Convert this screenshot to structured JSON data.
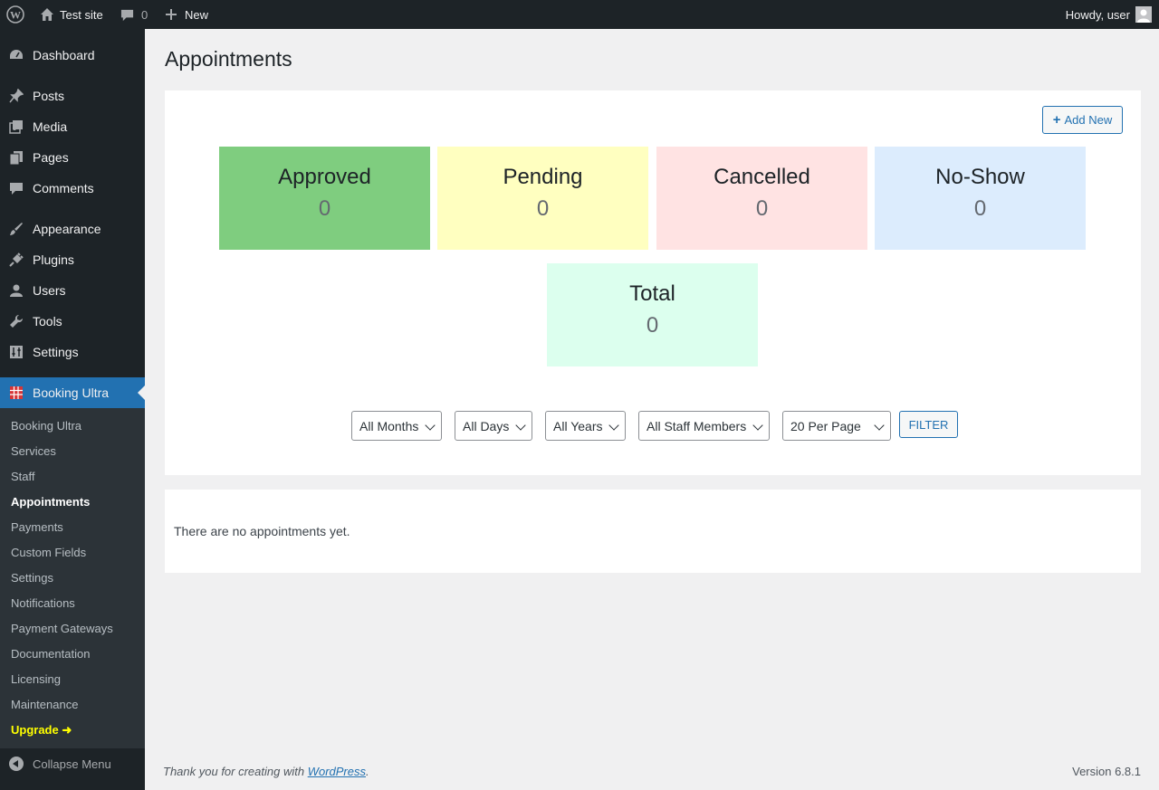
{
  "admin_bar": {
    "site_name": "Test site",
    "comments_count": "0",
    "new_label": "New",
    "howdy": "Howdy, user"
  },
  "sidebar": {
    "items": [
      {
        "label": "Dashboard",
        "icon": "dashboard-icon"
      },
      {
        "label": "Posts",
        "icon": "pushpin-icon"
      },
      {
        "label": "Media",
        "icon": "media-icon"
      },
      {
        "label": "Pages",
        "icon": "pages-icon"
      },
      {
        "label": "Comments",
        "icon": "comment-icon"
      },
      {
        "label": "Appearance",
        "icon": "paintbrush-icon"
      },
      {
        "label": "Plugins",
        "icon": "plugin-icon"
      },
      {
        "label": "Users",
        "icon": "user-icon"
      },
      {
        "label": "Tools",
        "icon": "wrench-icon"
      },
      {
        "label": "Settings",
        "icon": "settings-icon"
      },
      {
        "label": "Booking Ultra",
        "icon": "calendar-grid-icon"
      }
    ],
    "submenu": [
      {
        "label": "Booking Ultra"
      },
      {
        "label": "Services"
      },
      {
        "label": "Staff"
      },
      {
        "label": "Appointments"
      },
      {
        "label": "Payments"
      },
      {
        "label": "Custom Fields"
      },
      {
        "label": "Settings"
      },
      {
        "label": "Notifications"
      },
      {
        "label": "Payment Gateways"
      },
      {
        "label": "Documentation"
      },
      {
        "label": "Licensing"
      },
      {
        "label": "Maintenance"
      },
      {
        "label": "Upgrade ➜"
      }
    ],
    "collapse_label": "Collapse Menu"
  },
  "page": {
    "title": "Appointments",
    "add_new_label": "Add New",
    "stats": [
      {
        "label": "Approved",
        "value": "0",
        "color": "#7fcd7f"
      },
      {
        "label": "Pending",
        "value": "0",
        "color": "#ffffc0"
      },
      {
        "label": "Cancelled",
        "value": "0",
        "color": "#ffe3e3"
      },
      {
        "label": "No-Show",
        "value": "0",
        "color": "#dcecfd"
      },
      {
        "label": "Total",
        "value": "0",
        "color": "#dcffee"
      }
    ],
    "filters": {
      "months": "All Months",
      "days": "All Days",
      "years": "All Years",
      "staff": "All Staff Members",
      "per_page": "20 Per Page",
      "filter_label": "FILTER"
    },
    "empty_message": "There are no appointments yet."
  },
  "footer": {
    "thanks_prefix": "Thank you for creating with ",
    "thanks_link": "WordPress",
    "thanks_suffix": ".",
    "version": "Version 6.8.1"
  },
  "colors": {
    "admin_dark": "#1d2327",
    "submenu_bg": "#2c3338",
    "accent": "#2271b1",
    "upgrade": "#ffff00"
  }
}
